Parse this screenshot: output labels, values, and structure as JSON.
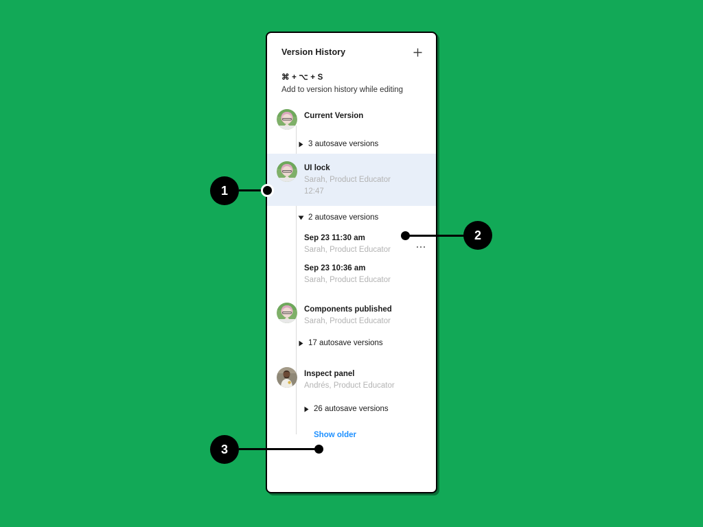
{
  "theme": {
    "background_color": "#12A957",
    "panel_background": "#FFFFFF",
    "panel_border": "#000000",
    "highlight_row_color": "#E8EFF9",
    "link_color": "#1E90FF",
    "muted_text_color": "#B3B3B3",
    "callout_color": "#000000"
  },
  "panel": {
    "header": {
      "title": "Version History",
      "add_icon": "plus-icon"
    },
    "shortcut": {
      "keys": "⌘ + ⌥ + S",
      "description": "Add to version history while editing"
    },
    "entries": [
      {
        "type": "version",
        "title": "Current Version",
        "author": "",
        "time": "",
        "avatar": "sarah-avatar",
        "highlighted": false
      },
      {
        "type": "autosave-group",
        "label": "3 autosave versions",
        "expanded": false,
        "triangle_icon": "chevron-right-icon"
      },
      {
        "type": "version",
        "title": "UI lock",
        "author": "Sarah, Product Educator",
        "time": "12:47",
        "avatar": "sarah-avatar",
        "highlighted": true
      },
      {
        "type": "autosave-group",
        "label": "2 autosave versions",
        "expanded": true,
        "triangle_icon": "chevron-down-icon"
      },
      {
        "type": "autosave-entry",
        "title": "Sep 23 11:30 am",
        "author": "Sarah, Product Educator",
        "has_menu": true,
        "menu_icon": "more-horizontal-icon"
      },
      {
        "type": "autosave-entry",
        "title": "Sep 23 10:36 am",
        "author": "Sarah, Product Educator",
        "has_menu": false
      },
      {
        "type": "version",
        "title": "Components published",
        "author": "Sarah, Product Educator",
        "time": "",
        "avatar": "sarah-avatar",
        "highlighted": false
      },
      {
        "type": "autosave-group",
        "label": "17 autosave versions",
        "expanded": false,
        "triangle_icon": "chevron-right-icon"
      },
      {
        "type": "version",
        "title": "Inspect panel",
        "author": "Andrés, Product Educator",
        "time": "",
        "avatar": "andres-avatar",
        "highlighted": false
      },
      {
        "type": "autosave-group",
        "label": "26 autosave versions",
        "expanded": false,
        "triangle_icon": "chevron-right-icon"
      }
    ],
    "show_older_label": "Show older"
  },
  "callouts": [
    {
      "number": "1",
      "target": "ui-lock-row",
      "side": "left"
    },
    {
      "number": "2",
      "target": "2-autosave-versions-group",
      "side": "right"
    },
    {
      "number": "3",
      "target": "show-older-link",
      "side": "left"
    }
  ]
}
